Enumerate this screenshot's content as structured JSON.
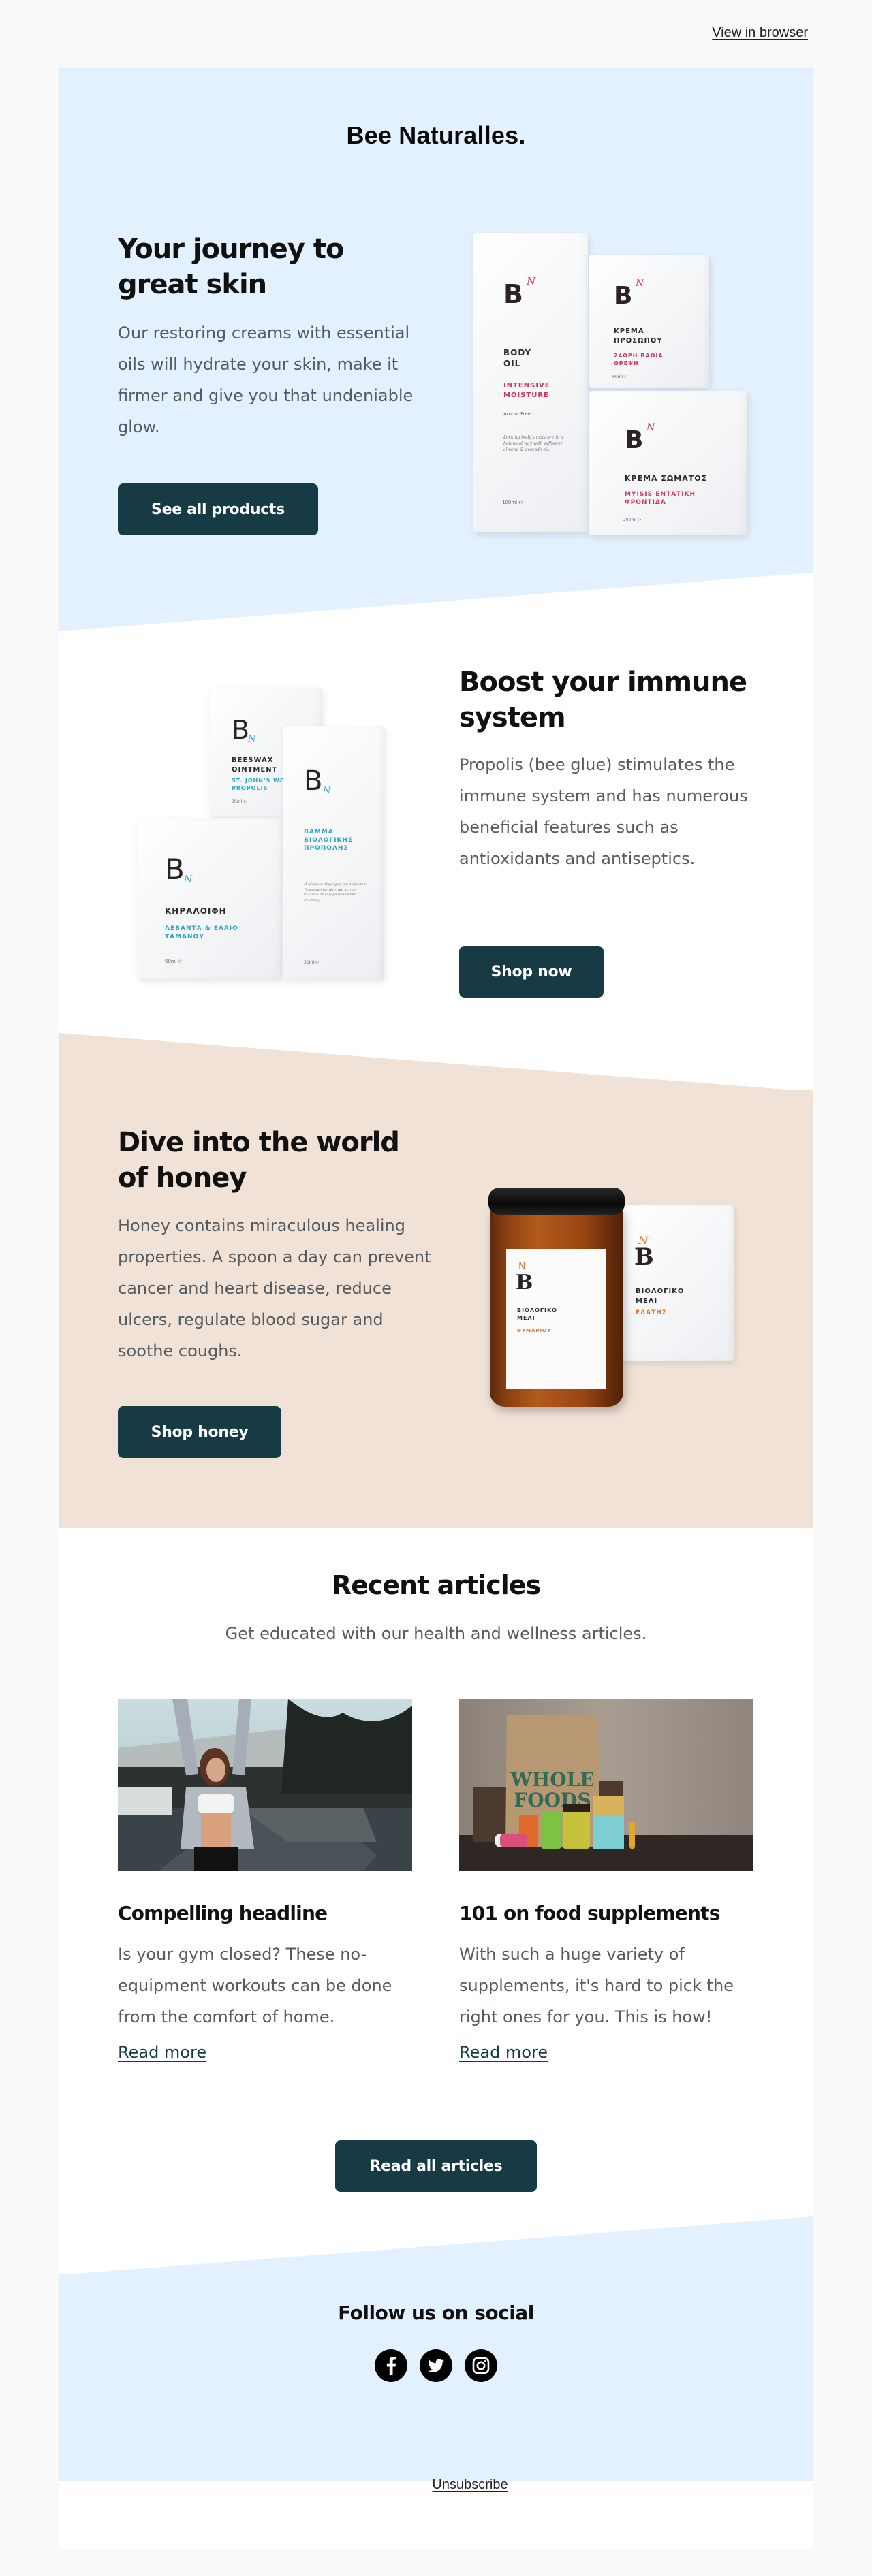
{
  "top_bar": {
    "view_in_browser": "View in browser"
  },
  "brand": {
    "name": "Bee Naturalles."
  },
  "colors": {
    "page_bg": "#f9f9f9",
    "blue_section": "#e3f0fe",
    "beige_section": "#f0e2d6",
    "button_bg": "#163b45",
    "button_text": "#ffffff",
    "heading": "#111111",
    "body_text": "#555b5f",
    "accent_red": "#d0335a",
    "accent_teal": "#2aa6c4",
    "accent_orange": "#e0752e"
  },
  "hero": {
    "title": "Your journey to great skin",
    "text": "Our restoring creams with essential oils will hydrate your skin, make it firmer and give you that undeniable glow.",
    "button": "See all products",
    "products": [
      {
        "mark": "B",
        "sup": "N",
        "name": "BODY OIL",
        "sub": "INTENSIVE MOISTURE",
        "note": "Aroma Free",
        "desc": "Locking body's moisture in a botanical way with safflower, almond & avocado oil.",
        "volume": "100ml ℮"
      },
      {
        "mark": "B",
        "sup": "N",
        "name": "ΚΡΕΜΑ ΠΡΟΣΩΠΟΥ",
        "sub": "24ΩΡΗ ΒΑΘΙΑ ΘΡΕΨΗ",
        "volume": "60ml ℮"
      },
      {
        "mark": "B",
        "sup": "N",
        "name": "ΚΡΕΜΑ ΣΩΜΑΤΟΣ",
        "sub": "ΜΥΙSIS ΕΝΤΑΤΙΚΗ ΦΡΟΝΤΙΔΑ",
        "volume": "200ml ℮"
      }
    ]
  },
  "immune": {
    "title": "Boost your immune system",
    "text": "Propolis (bee glue) stimulates the immune system and has numerous beneficial features such as antioxidants and antiseptics.",
    "button": "Shop now",
    "products": [
      {
        "mark": "B",
        "sub_mark": "N",
        "name": "BEESWAX OINTMENT",
        "sub": "ST. JOHN'S WORT & PROPOLIS",
        "volume": "30ml ℮"
      },
      {
        "mark": "B",
        "sub_mark": "N",
        "name": "ΚΗΡΑΛΟΙΦΗ",
        "sub": "ΛΕΒΑΝΤΑ & ΕΛΑΙΟ ΤΑΜΑΝΟΥ",
        "volume": "60ml ℮"
      },
      {
        "mark": "B",
        "sub_mark": "N",
        "name": "",
        "sub": "ΒΑΜΜΑ ΒΙΟΛΟΓΙΚΗΣ ΠΡΟΠΟΛΗΣ",
        "volume": "30ml ℮"
      }
    ]
  },
  "honey": {
    "title": "Dive into the world of honey",
    "text": "Honey contains miraculous healing properties. A spoon a day can prevent cancer and heart disease, reduce ulcers, regulate blood sugar and soothe coughs.",
    "button": "Shop honey",
    "products": [
      {
        "mark": "B",
        "sup": "N",
        "name": "ΒΙΟΛΟΓΙΚΟ ΜΕΛΙ",
        "sub": "ΘΥΜΑΡΙΟΥ"
      },
      {
        "mark": "B",
        "sup": "N",
        "name": "ΒΙΟΛΟΓΙΚΟ ΜΕΛΙ",
        "sub": "ΕΛΑΤΗΣ"
      }
    ]
  },
  "articles": {
    "title": "Recent articles",
    "subtitle": "Get educated with our health and wellness articles.",
    "items": [
      {
        "image": "woman stretching on a dock",
        "title": "Compelling headline",
        "text": "Is your gym closed? These no-equipment workouts can be done from the comfort of home.",
        "link": "Read more"
      },
      {
        "image": "Whole Foods bag with supplements",
        "title": "101 on food supplements",
        "text": "With such a huge variety of supplements, it's hard to pick the right ones for you. This is how!",
        "link": "Read more",
        "bag_text": "WHOLE FOODS"
      }
    ],
    "button": "Read all articles"
  },
  "footer": {
    "follow": "Follow us on social",
    "socials": [
      {
        "name": "facebook",
        "icon": "facebook-icon"
      },
      {
        "name": "twitter",
        "icon": "twitter-icon"
      },
      {
        "name": "instagram",
        "icon": "instagram-icon"
      }
    ],
    "unsubscribe": "Unsubscribe"
  }
}
